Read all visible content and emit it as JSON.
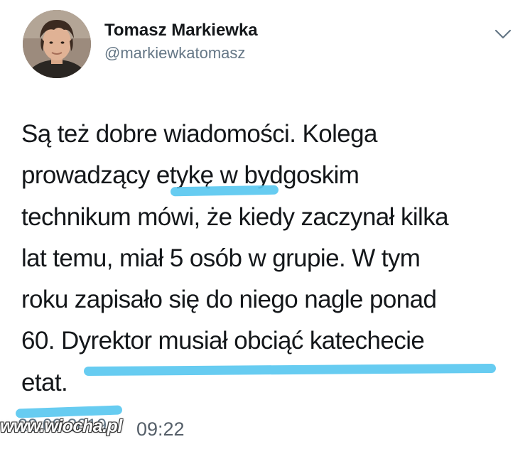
{
  "author": {
    "display_name": "Tomasz Markiewka",
    "handle": "@markiewkatomasz"
  },
  "icons": {
    "menu": "chevron-down-icon",
    "avatar": "avatar"
  },
  "tweet": {
    "lines": [
      "Są też dobre wiadomości. Kolega",
      "prowadzący etykę w bydgoskim",
      "technikum mówi, że kiedy zaczynał kilka",
      "lat temu, miał 5 osób w grupie.  W tym",
      "roku zapisało się do niego nagle ponad",
      "60. Dyrektor musiał obciąć katechecie",
      "etat."
    ],
    "time": "09:22",
    "date_obscured": "22.09.2019"
  },
  "watermark": "www.wiocha.pl",
  "colors": {
    "highlighter": "#5ac8f0",
    "secondary_text": "#657786"
  }
}
